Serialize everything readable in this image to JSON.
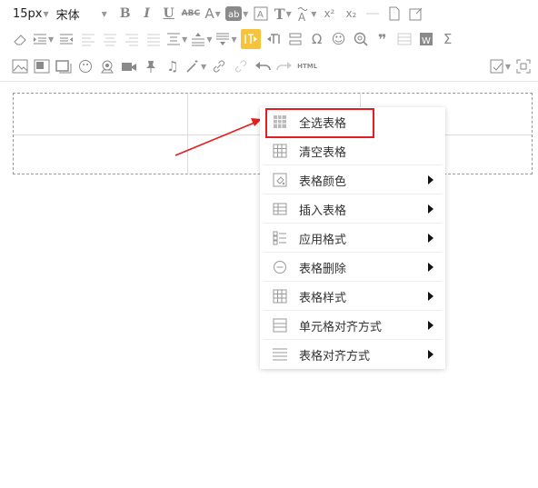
{
  "toolbar": {
    "font_size": "15px",
    "font_family": "宋体",
    "html_label": "HTML",
    "bold": "B",
    "italic": "I",
    "underline": "U",
    "strike": "ABC",
    "font_color": "A",
    "text_t": "T"
  },
  "menu": {
    "items": [
      {
        "label": "全选表格",
        "icon": "table-grid-icon",
        "submenu": false
      },
      {
        "label": "清空表格",
        "icon": "table-clear-icon",
        "submenu": false
      },
      {
        "label": "表格颜色",
        "icon": "color-bucket-icon",
        "submenu": true
      },
      {
        "label": "插入表格",
        "icon": "table-insert-icon",
        "submenu": true
      },
      {
        "label": "应用格式",
        "icon": "list-format-icon",
        "submenu": true
      },
      {
        "label": "表格删除",
        "icon": "minus-circle-icon",
        "submenu": true
      },
      {
        "label": "表格样式",
        "icon": "table-style-icon",
        "submenu": true
      },
      {
        "label": "单元格对齐方式",
        "icon": "cell-align-icon",
        "submenu": true
      },
      {
        "label": "表格对齐方式",
        "icon": "table-align-icon",
        "submenu": true
      }
    ]
  },
  "colors": {
    "highlight": "#e41e1e",
    "arrow": "#e41e1e",
    "active_button": "#f7c33a"
  }
}
